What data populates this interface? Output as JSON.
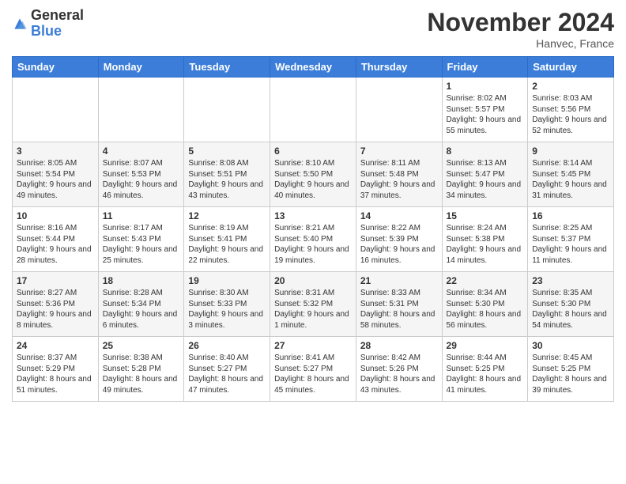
{
  "logo": {
    "general": "General",
    "blue": "Blue"
  },
  "title": "November 2024",
  "location": "Hanvec, France",
  "days_header": [
    "Sunday",
    "Monday",
    "Tuesday",
    "Wednesday",
    "Thursday",
    "Friday",
    "Saturday"
  ],
  "weeks": [
    [
      {
        "day": "",
        "info": ""
      },
      {
        "day": "",
        "info": ""
      },
      {
        "day": "",
        "info": ""
      },
      {
        "day": "",
        "info": ""
      },
      {
        "day": "",
        "info": ""
      },
      {
        "day": "1",
        "info": "Sunrise: 8:02 AM\nSunset: 5:57 PM\nDaylight: 9 hours and 55 minutes."
      },
      {
        "day": "2",
        "info": "Sunrise: 8:03 AM\nSunset: 5:56 PM\nDaylight: 9 hours and 52 minutes."
      }
    ],
    [
      {
        "day": "3",
        "info": "Sunrise: 8:05 AM\nSunset: 5:54 PM\nDaylight: 9 hours and 49 minutes."
      },
      {
        "day": "4",
        "info": "Sunrise: 8:07 AM\nSunset: 5:53 PM\nDaylight: 9 hours and 46 minutes."
      },
      {
        "day": "5",
        "info": "Sunrise: 8:08 AM\nSunset: 5:51 PM\nDaylight: 9 hours and 43 minutes."
      },
      {
        "day": "6",
        "info": "Sunrise: 8:10 AM\nSunset: 5:50 PM\nDaylight: 9 hours and 40 minutes."
      },
      {
        "day": "7",
        "info": "Sunrise: 8:11 AM\nSunset: 5:48 PM\nDaylight: 9 hours and 37 minutes."
      },
      {
        "day": "8",
        "info": "Sunrise: 8:13 AM\nSunset: 5:47 PM\nDaylight: 9 hours and 34 minutes."
      },
      {
        "day": "9",
        "info": "Sunrise: 8:14 AM\nSunset: 5:45 PM\nDaylight: 9 hours and 31 minutes."
      }
    ],
    [
      {
        "day": "10",
        "info": "Sunrise: 8:16 AM\nSunset: 5:44 PM\nDaylight: 9 hours and 28 minutes."
      },
      {
        "day": "11",
        "info": "Sunrise: 8:17 AM\nSunset: 5:43 PM\nDaylight: 9 hours and 25 minutes."
      },
      {
        "day": "12",
        "info": "Sunrise: 8:19 AM\nSunset: 5:41 PM\nDaylight: 9 hours and 22 minutes."
      },
      {
        "day": "13",
        "info": "Sunrise: 8:21 AM\nSunset: 5:40 PM\nDaylight: 9 hours and 19 minutes."
      },
      {
        "day": "14",
        "info": "Sunrise: 8:22 AM\nSunset: 5:39 PM\nDaylight: 9 hours and 16 minutes."
      },
      {
        "day": "15",
        "info": "Sunrise: 8:24 AM\nSunset: 5:38 PM\nDaylight: 9 hours and 14 minutes."
      },
      {
        "day": "16",
        "info": "Sunrise: 8:25 AM\nSunset: 5:37 PM\nDaylight: 9 hours and 11 minutes."
      }
    ],
    [
      {
        "day": "17",
        "info": "Sunrise: 8:27 AM\nSunset: 5:36 PM\nDaylight: 9 hours and 8 minutes."
      },
      {
        "day": "18",
        "info": "Sunrise: 8:28 AM\nSunset: 5:34 PM\nDaylight: 9 hours and 6 minutes."
      },
      {
        "day": "19",
        "info": "Sunrise: 8:30 AM\nSunset: 5:33 PM\nDaylight: 9 hours and 3 minutes."
      },
      {
        "day": "20",
        "info": "Sunrise: 8:31 AM\nSunset: 5:32 PM\nDaylight: 9 hours and 1 minute."
      },
      {
        "day": "21",
        "info": "Sunrise: 8:33 AM\nSunset: 5:31 PM\nDaylight: 8 hours and 58 minutes."
      },
      {
        "day": "22",
        "info": "Sunrise: 8:34 AM\nSunset: 5:30 PM\nDaylight: 8 hours and 56 minutes."
      },
      {
        "day": "23",
        "info": "Sunrise: 8:35 AM\nSunset: 5:30 PM\nDaylight: 8 hours and 54 minutes."
      }
    ],
    [
      {
        "day": "24",
        "info": "Sunrise: 8:37 AM\nSunset: 5:29 PM\nDaylight: 8 hours and 51 minutes."
      },
      {
        "day": "25",
        "info": "Sunrise: 8:38 AM\nSunset: 5:28 PM\nDaylight: 8 hours and 49 minutes."
      },
      {
        "day": "26",
        "info": "Sunrise: 8:40 AM\nSunset: 5:27 PM\nDaylight: 8 hours and 47 minutes."
      },
      {
        "day": "27",
        "info": "Sunrise: 8:41 AM\nSunset: 5:27 PM\nDaylight: 8 hours and 45 minutes."
      },
      {
        "day": "28",
        "info": "Sunrise: 8:42 AM\nSunset: 5:26 PM\nDaylight: 8 hours and 43 minutes."
      },
      {
        "day": "29",
        "info": "Sunrise: 8:44 AM\nSunset: 5:25 PM\nDaylight: 8 hours and 41 minutes."
      },
      {
        "day": "30",
        "info": "Sunrise: 8:45 AM\nSunset: 5:25 PM\nDaylight: 8 hours and 39 minutes."
      }
    ]
  ]
}
